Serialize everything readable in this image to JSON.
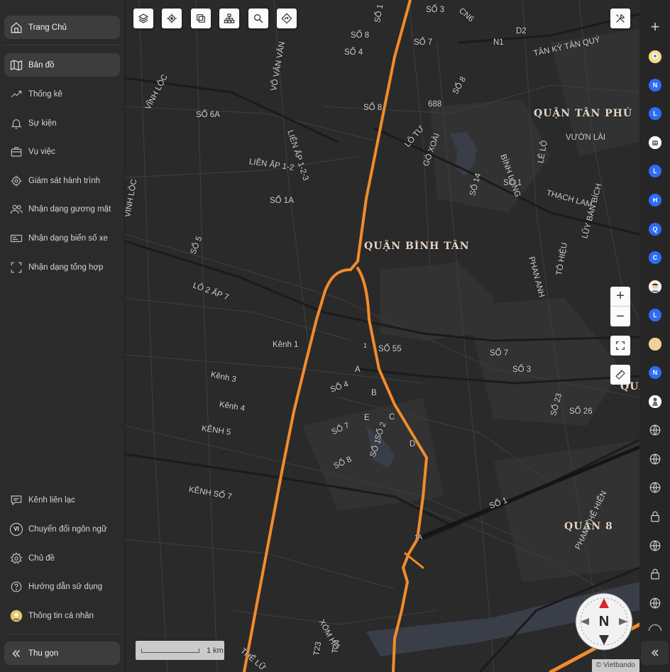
{
  "sidebar": {
    "home": "Trang Chủ",
    "items": [
      {
        "label": "Bản đồ",
        "icon": "map-icon",
        "active": true
      },
      {
        "label": "Thống kê",
        "icon": "chart-icon"
      },
      {
        "label": "Sự kiện",
        "icon": "bell-icon"
      },
      {
        "label": "Vụ việc",
        "icon": "briefcase-icon"
      },
      {
        "label": "Giám sát hành trình",
        "icon": "target-icon"
      },
      {
        "label": "Nhận dạng gương mặt",
        "icon": "users-icon"
      },
      {
        "label": "Nhận dạng biển số xe",
        "icon": "plate-icon"
      },
      {
        "label": "Nhận dạng tổng hợp",
        "icon": "scan-icon"
      }
    ],
    "bottom": [
      {
        "label": "Kênh liên lạc",
        "icon": "message-icon"
      },
      {
        "label": "Chuyển đổi ngôn ngữ",
        "icon": "language-icon",
        "badge": "VI"
      },
      {
        "label": "Chủ đề",
        "icon": "gear-icon"
      },
      {
        "label": "Hướng dẫn sử dụng",
        "icon": "help-icon"
      },
      {
        "label": "Thông tin cá nhân",
        "icon": "avatar-icon"
      }
    ],
    "collapse": "Thu gọn"
  },
  "map": {
    "labels": {
      "quan_binh_tan": "QUẬN BÌNH TÂN",
      "quan_tan_phu": "QUẬN TÂN PHÚ",
      "quan_8": "QUẬN 8",
      "quan_edge": "QUẬ",
      "vinh_loc_1": "VĨNH LỘC",
      "vinh_loc_2": "VĨNH LỘC",
      "vo_van_van": "VÕ VĂN VÂN",
      "so_6a": "SỐ 6A",
      "lien_ap_123": "LIÊN ẤP 1-2-3",
      "lien_ap_12": "LIÊN ẤP 1-2",
      "so_1a": "SỐ 1A",
      "so_5": "SỐ 5",
      "lo_2_ap_7": "LÔ 2 ẤP 7",
      "so_8_a": "SỐ 8",
      "so_4_a": "SỐ 4",
      "so_1_top": "SỐ 1",
      "so_3_top": "SỐ 3",
      "cn6": "CN6",
      "so_7_top": "SỐ 7",
      "so_8_b": "SỐ 8",
      "n688": "688",
      "so_8_c": "SỐ 8",
      "lo_tu": "LÔ TƯ",
      "go_xoai": "GÒ XOÀI",
      "so_14": "SỐ 14",
      "n1": "N1",
      "d2": "D2",
      "tan_ky_tan_quy": "TÂN KỲ TÂN QUÝ",
      "vuon_lai": "VƯỜN LÀI",
      "binh_long": "BÌNH LONG",
      "le_lo": "LÊ LỘ",
      "so_1_c": "SỐ 1",
      "thach_lam": "THẠCH LAM",
      "luy_ban_bich": "LŨY BÁN BÍCH",
      "phan_anh": "PHAN ANH",
      "to_hieu": "TÔ HIỆU",
      "kenh_1": "Kênh 1",
      "kenh_3": "Kênh 3",
      "kenh_4": "Kênh 4",
      "kenh_5": "KÊNH 5",
      "kenh_so_7": "KÊNH SỐ 7",
      "so_55": "SỐ 55",
      "so_7_b": "SỐ 7",
      "so_3_b": "SỐ 3",
      "so_23": "SỐ 23",
      "so_26": "SỐ 26",
      "so_4_b": "SỐ 4",
      "so_7_c": "SỐ 7",
      "so_2": "SỐ 2",
      "so_1_d": "SỐ 1",
      "so_8_d": "SỐ 8",
      "a": "A",
      "b": "B",
      "c": "C",
      "d": "D",
      "e": "E",
      "so_1_e": "SỐ 1",
      "pham_the_hien": "PHẠM THẾ HIỂN",
      "xom_ho": "XÓM HỐ",
      "t23": "T23",
      "t24": "T24",
      "the_lu": "THẾ LỮ",
      "l1a": "1A",
      "l1": "1"
    },
    "scale": "1 km",
    "attribution": "© Vietbando",
    "compass": "N",
    "zoom_in": "+",
    "zoom_out": "−"
  },
  "rail": {
    "add": "+",
    "items": [
      {
        "type": "avatar",
        "icon": "avatar-icon"
      },
      {
        "type": "letter",
        "text": "N",
        "color": "#2d6cf6"
      },
      {
        "type": "letter",
        "text": "L",
        "color": "#2d6cf6"
      },
      {
        "type": "avatar",
        "icon": "robot-avatar-icon"
      },
      {
        "type": "letter",
        "text": "L",
        "color": "#2d6cf6"
      },
      {
        "type": "letter",
        "text": "H",
        "color": "#2d6cf6"
      },
      {
        "type": "letter",
        "text": "Q",
        "color": "#2d6cf6"
      },
      {
        "type": "letter",
        "text": "C",
        "color": "#2d6cf6"
      },
      {
        "type": "avatar",
        "icon": "face-avatar-icon"
      },
      {
        "type": "letter",
        "text": "L",
        "color": "#2d6cf6"
      },
      {
        "type": "avatar",
        "icon": "blank-avatar-icon"
      },
      {
        "type": "letter",
        "text": "N",
        "color": "#2d6cf6"
      },
      {
        "type": "avatar",
        "icon": "figure-avatar-icon"
      },
      {
        "type": "icon",
        "icon": "globe-icon"
      },
      {
        "type": "icon",
        "icon": "globe-icon"
      },
      {
        "type": "icon",
        "icon": "globe-icon"
      },
      {
        "type": "icon",
        "icon": "lock-icon"
      },
      {
        "type": "icon",
        "icon": "globe-icon"
      },
      {
        "type": "icon",
        "icon": "lock-icon"
      },
      {
        "type": "icon",
        "icon": "globe-icon"
      }
    ],
    "collapse": "«"
  },
  "colors": {
    "accent_road": "#f38b2c",
    "letter_badge": "#2d6cf6",
    "sidebar_bg": "#2b2b2b",
    "map_bg": "#2a2a2a"
  }
}
